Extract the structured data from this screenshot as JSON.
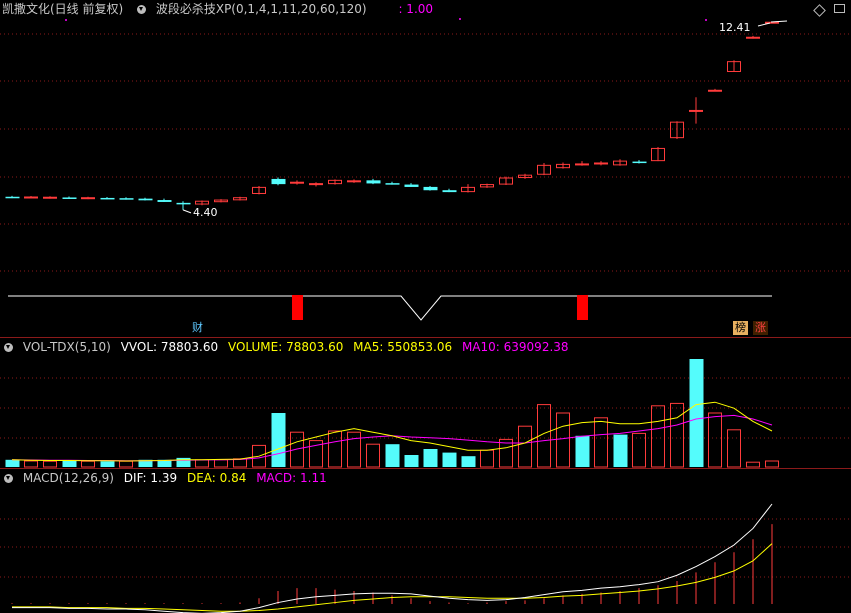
{
  "main": {
    "stock_name": "凯撒文化(日线 前复权)",
    "indicator_name": "波段必杀技XP(0,1,4,1,11,20,60,120)",
    "indicator_value": ": 1.00",
    "high_label": "12.41",
    "low_label": "4.40",
    "tags": {
      "finance": "财",
      "rank": "榜",
      "limit_up": "涨"
    },
    "colors": {
      "up": "#ff3b3b",
      "down": "#54fcfc",
      "purple": "#ff00ff",
      "white": "#ffffff"
    }
  },
  "volume": {
    "title": "VOL-TDX(5,10)",
    "vvol": "VVOL: 78803.60",
    "volume": "VOLUME: 78803.60",
    "ma5": "MA5: 550853.06",
    "ma10": "MA10: 639092.38"
  },
  "macd": {
    "title": "MACD(12,26,9)",
    "dif": "DIF: 1.39",
    "dea": "DEA: 0.84",
    "macd": "MACD: 1.11"
  },
  "chart_data": {
    "type": "candlestick",
    "candles": [
      {
        "o": 4.96,
        "h": 5.0,
        "l": 4.9,
        "c": 4.93
      },
      {
        "o": 4.94,
        "h": 4.99,
        "l": 4.9,
        "c": 4.95
      },
      {
        "o": 4.93,
        "h": 4.98,
        "l": 4.88,
        "c": 4.94
      },
      {
        "o": 4.93,
        "h": 4.97,
        "l": 4.88,
        "c": 4.92
      },
      {
        "o": 4.91,
        "h": 4.96,
        "l": 4.86,
        "c": 4.92
      },
      {
        "o": 4.91,
        "h": 4.95,
        "l": 4.85,
        "c": 4.9
      },
      {
        "o": 4.9,
        "h": 4.94,
        "l": 4.84,
        "c": 4.89
      },
      {
        "o": 4.88,
        "h": 4.92,
        "l": 4.8,
        "c": 4.83
      },
      {
        "o": 4.82,
        "h": 4.88,
        "l": 4.74,
        "c": 4.76
      },
      {
        "o": 4.7,
        "h": 4.77,
        "l": 4.4,
        "c": 4.66
      },
      {
        "o": 4.65,
        "h": 4.8,
        "l": 4.6,
        "c": 4.77
      },
      {
        "o": 4.75,
        "h": 4.86,
        "l": 4.72,
        "c": 4.82
      },
      {
        "o": 4.83,
        "h": 4.96,
        "l": 4.8,
        "c": 4.92
      },
      {
        "o": 5.1,
        "h": 5.42,
        "l": 5.06,
        "c": 5.36
      },
      {
        "o": 5.72,
        "h": 5.78,
        "l": 5.45,
        "c": 5.52
      },
      {
        "o": 5.54,
        "h": 5.66,
        "l": 5.48,
        "c": 5.58
      },
      {
        "o": 5.48,
        "h": 5.58,
        "l": 5.4,
        "c": 5.52
      },
      {
        "o": 5.52,
        "h": 5.7,
        "l": 5.48,
        "c": 5.66
      },
      {
        "o": 5.62,
        "h": 5.7,
        "l": 5.55,
        "c": 5.64
      },
      {
        "o": 5.66,
        "h": 5.72,
        "l": 5.5,
        "c": 5.55
      },
      {
        "o": 5.54,
        "h": 5.6,
        "l": 5.48,
        "c": 5.52
      },
      {
        "o": 5.48,
        "h": 5.54,
        "l": 5.38,
        "c": 5.4
      },
      {
        "o": 5.38,
        "h": 5.42,
        "l": 5.22,
        "c": 5.26
      },
      {
        "o": 5.24,
        "h": 5.3,
        "l": 5.16,
        "c": 5.18
      },
      {
        "o": 5.18,
        "h": 5.5,
        "l": 5.14,
        "c": 5.36
      },
      {
        "o": 5.38,
        "h": 5.52,
        "l": 5.34,
        "c": 5.48
      },
      {
        "o": 5.5,
        "h": 5.82,
        "l": 5.46,
        "c": 5.76
      },
      {
        "o": 5.78,
        "h": 5.94,
        "l": 5.72,
        "c": 5.88
      },
      {
        "o": 5.92,
        "h": 6.4,
        "l": 5.88,
        "c": 6.3
      },
      {
        "o": 6.2,
        "h": 6.42,
        "l": 6.16,
        "c": 6.34
      },
      {
        "o": 6.34,
        "h": 6.48,
        "l": 6.28,
        "c": 6.36
      },
      {
        "o": 6.36,
        "h": 6.48,
        "l": 6.3,
        "c": 6.4
      },
      {
        "o": 6.32,
        "h": 6.56,
        "l": 6.28,
        "c": 6.48
      },
      {
        "o": 6.46,
        "h": 6.52,
        "l": 6.38,
        "c": 6.42
      },
      {
        "o": 6.5,
        "h": 7.08,
        "l": 6.48,
        "c": 7.02
      },
      {
        "o": 7.48,
        "h": 8.18,
        "l": 7.42,
        "c": 8.14
      },
      {
        "o": 8.6,
        "h": 9.2,
        "l": 8.08,
        "c": 8.64
      },
      {
        "o": 9.48,
        "h": 9.56,
        "l": 9.46,
        "c": 9.5
      },
      {
        "o": 10.3,
        "h": 10.78,
        "l": 10.28,
        "c": 10.72
      },
      {
        "o": 11.72,
        "h": 11.82,
        "l": 11.7,
        "c": 11.76
      },
      {
        "o": 12.4,
        "h": 12.41,
        "l": 12.38,
        "c": 12.4
      }
    ],
    "signal_markers": [
      15,
      30
    ],
    "v_marker": 21,
    "volume_bars": [
      {
        "v": 30,
        "d": "down"
      },
      {
        "v": 25,
        "d": "up"
      },
      {
        "v": 24,
        "d": "up"
      },
      {
        "v": 28,
        "d": "down"
      },
      {
        "v": 24,
        "d": "up"
      },
      {
        "v": 24,
        "d": "down"
      },
      {
        "v": 24,
        "d": "up"
      },
      {
        "v": 30,
        "d": "down"
      },
      {
        "v": 30,
        "d": "down"
      },
      {
        "v": 38,
        "d": "down"
      },
      {
        "v": 30,
        "d": "up"
      },
      {
        "v": 30,
        "d": "up"
      },
      {
        "v": 34,
        "d": "up"
      },
      {
        "v": 90,
        "d": "up"
      },
      {
        "v": 225,
        "d": "down"
      },
      {
        "v": 145,
        "d": "up"
      },
      {
        "v": 110,
        "d": "up"
      },
      {
        "v": 150,
        "d": "up"
      },
      {
        "v": 145,
        "d": "up"
      },
      {
        "v": 95,
        "d": "up"
      },
      {
        "v": 95,
        "d": "down"
      },
      {
        "v": 50,
        "d": "down"
      },
      {
        "v": 75,
        "d": "down"
      },
      {
        "v": 60,
        "d": "down"
      },
      {
        "v": 45,
        "d": "down"
      },
      {
        "v": 70,
        "d": "up"
      },
      {
        "v": 115,
        "d": "up"
      },
      {
        "v": 170,
        "d": "up"
      },
      {
        "v": 260,
        "d": "up"
      },
      {
        "v": 225,
        "d": "up"
      },
      {
        "v": 130,
        "d": "down"
      },
      {
        "v": 205,
        "d": "up"
      },
      {
        "v": 135,
        "d": "down"
      },
      {
        "v": 140,
        "d": "up"
      },
      {
        "v": 255,
        "d": "up"
      },
      {
        "v": 265,
        "d": "up"
      },
      {
        "v": 450,
        "d": "down"
      },
      {
        "v": 225,
        "d": "up"
      },
      {
        "v": 155,
        "d": "up"
      },
      {
        "v": 20,
        "d": "up"
      },
      {
        "v": 25,
        "d": "up"
      }
    ],
    "vol_ma5": [
      30,
      28,
      27,
      27,
      26,
      26,
      25,
      26,
      27,
      30,
      30,
      32,
      33,
      45,
      75,
      105,
      125,
      145,
      160,
      145,
      130,
      110,
      100,
      85,
      70,
      70,
      80,
      100,
      140,
      170,
      185,
      190,
      180,
      180,
      190,
      205,
      260,
      270,
      245,
      190,
      150
    ],
    "vol_ma10": [
      30,
      29,
      28,
      28,
      27,
      27,
      26,
      26,
      27,
      28,
      29,
      30,
      31,
      38,
      55,
      75,
      90,
      105,
      118,
      125,
      130,
      125,
      122,
      118,
      112,
      105,
      100,
      100,
      110,
      118,
      128,
      135,
      140,
      150,
      160,
      175,
      200,
      210,
      215,
      200,
      175
    ],
    "macd_dif": [
      -0.05,
      -0.05,
      -0.05,
      -0.06,
      -0.06,
      -0.07,
      -0.07,
      -0.08,
      -0.1,
      -0.12,
      -0.13,
      -0.12,
      -0.1,
      -0.05,
      0.02,
      0.07,
      0.1,
      0.12,
      0.14,
      0.15,
      0.15,
      0.14,
      0.11,
      0.08,
      0.06,
      0.05,
      0.06,
      0.09,
      0.13,
      0.17,
      0.19,
      0.22,
      0.24,
      0.27,
      0.31,
      0.4,
      0.52,
      0.66,
      0.82,
      1.05,
      1.39
    ],
    "macd_dea": [
      -0.04,
      -0.04,
      -0.04,
      -0.05,
      -0.05,
      -0.05,
      -0.06,
      -0.06,
      -0.07,
      -0.08,
      -0.09,
      -0.1,
      -0.1,
      -0.09,
      -0.07,
      -0.04,
      -0.01,
      0.02,
      0.05,
      0.07,
      0.09,
      0.1,
      0.1,
      0.1,
      0.09,
      0.08,
      0.08,
      0.08,
      0.09,
      0.11,
      0.12,
      0.14,
      0.16,
      0.18,
      0.21,
      0.25,
      0.3,
      0.37,
      0.46,
      0.6,
      0.84
    ],
    "macd_hist": [
      0.01,
      0.01,
      0.01,
      0.01,
      0.01,
      0.01,
      0.01,
      0.01,
      0.01,
      0.01,
      0.01,
      0.01,
      0.02,
      0.08,
      0.18,
      0.22,
      0.22,
      0.2,
      0.18,
      0.16,
      0.12,
      0.08,
      0.04,
      0.02,
      0.01,
      0.02,
      0.04,
      0.05,
      0.08,
      0.12,
      0.14,
      0.16,
      0.18,
      0.22,
      0.26,
      0.32,
      0.44,
      0.58,
      0.72,
      0.9,
      1.11
    ]
  }
}
